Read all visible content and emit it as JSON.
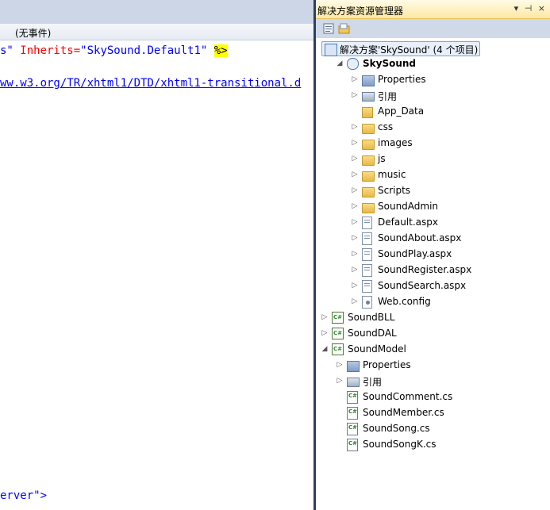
{
  "editor": {
    "events_dropdown": "(无事件)",
    "code_line1": {
      "a": "s\"",
      "b": " Inherits=",
      "c": "\"SkySound.Default1\"",
      "d": " ",
      "e": "%>"
    },
    "code_line2": "ww.w3.org/TR/xhtml1/DTD/xhtml1-transitional.d",
    "code_line3": "erver\">"
  },
  "explorer": {
    "title": "解决方案资源管理器",
    "title_buttons": "▾ ⊣ ×",
    "toolbar": [
      "properties-icon",
      "show-all-files-icon"
    ],
    "solution": "解决方案'SkySound' (4 个项目)",
    "tree": [
      {
        "label": "SkySound",
        "depth": 1,
        "arrow": "down",
        "icon": "web-project-icon",
        "bold": true
      },
      {
        "label": "Properties",
        "depth": 2,
        "arrow": "right",
        "icon": "properties-icon"
      },
      {
        "label": "引用",
        "depth": 2,
        "arrow": "right",
        "icon": "references-icon"
      },
      {
        "label": "App_Data",
        "depth": 2,
        "arrow": "none",
        "icon": "app-data-folder-icon"
      },
      {
        "label": "css",
        "depth": 2,
        "arrow": "right",
        "icon": "folder-icon"
      },
      {
        "label": "images",
        "depth": 2,
        "arrow": "right",
        "icon": "folder-icon"
      },
      {
        "label": "js",
        "depth": 2,
        "arrow": "right",
        "icon": "folder-icon"
      },
      {
        "label": "music",
        "depth": 2,
        "arrow": "right",
        "icon": "folder-icon"
      },
      {
        "label": "Scripts",
        "depth": 2,
        "arrow": "right",
        "icon": "folder-icon"
      },
      {
        "label": "SoundAdmin",
        "depth": 2,
        "arrow": "right",
        "icon": "folder-icon"
      },
      {
        "label": "Default.aspx",
        "depth": 2,
        "arrow": "right",
        "icon": "aspx-page-icon"
      },
      {
        "label": "SoundAbout.aspx",
        "depth": 2,
        "arrow": "right",
        "icon": "aspx-page-icon"
      },
      {
        "label": "SoundPlay.aspx",
        "depth": 2,
        "arrow": "right",
        "icon": "aspx-page-icon"
      },
      {
        "label": "SoundRegister.aspx",
        "depth": 2,
        "arrow": "right",
        "icon": "aspx-page-icon"
      },
      {
        "label": "SoundSearch.aspx",
        "depth": 2,
        "arrow": "right",
        "icon": "aspx-page-icon"
      },
      {
        "label": "Web.config",
        "depth": 2,
        "arrow": "right",
        "icon": "config-file-icon"
      },
      {
        "label": "SoundBLL",
        "depth": 0,
        "arrow": "right",
        "icon": "csharp-project-icon"
      },
      {
        "label": "SoundDAL",
        "depth": 0,
        "arrow": "right",
        "icon": "csharp-project-icon"
      },
      {
        "label": "SoundModel",
        "depth": 0,
        "arrow": "down",
        "icon": "csharp-project-icon"
      },
      {
        "label": "Properties",
        "depth": 1,
        "arrow": "right",
        "icon": "properties-icon"
      },
      {
        "label": "引用",
        "depth": 1,
        "arrow": "right",
        "icon": "references-icon"
      },
      {
        "label": "SoundComment.cs",
        "depth": 1,
        "arrow": "none",
        "icon": "cs-file-icon"
      },
      {
        "label": "SoundMember.cs",
        "depth": 1,
        "arrow": "none",
        "icon": "cs-file-icon"
      },
      {
        "label": "SoundSong.cs",
        "depth": 1,
        "arrow": "none",
        "icon": "cs-file-icon"
      },
      {
        "label": "SoundSongK.cs",
        "depth": 1,
        "arrow": "none",
        "icon": "cs-file-icon"
      }
    ]
  }
}
